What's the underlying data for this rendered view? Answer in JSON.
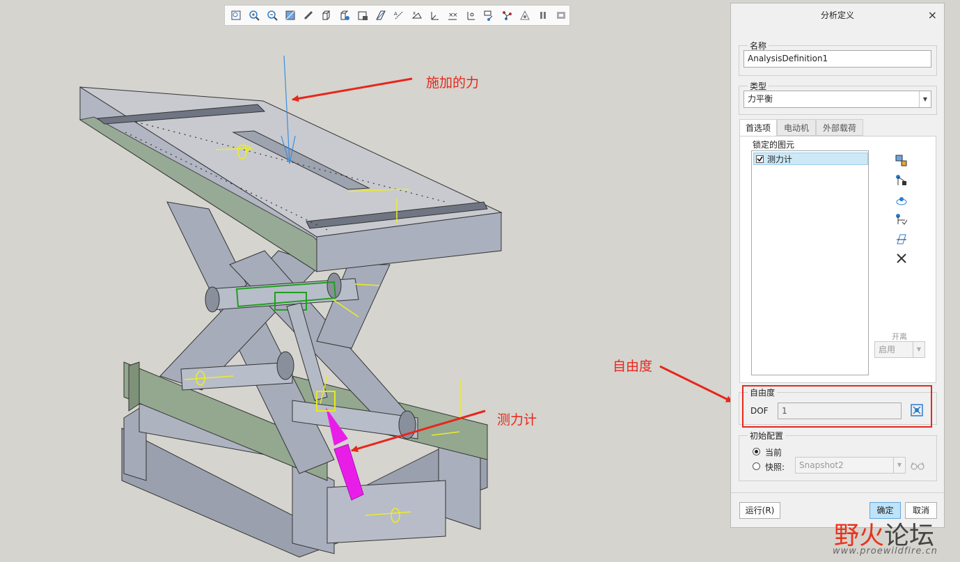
{
  "toolbar": {
    "icons": [
      "zoom-fit-icon",
      "zoom-in-icon",
      "zoom-out-icon",
      "repaint-icon",
      "orient-icon",
      "display-style-icon",
      "view-manager-icon",
      "saved-views-icon",
      "datum-planes-icon",
      "datum-axes-icon",
      "point-display-icon",
      "csys-display-icon",
      "spin-center-icon",
      "annotation-display-icon",
      "mechanism-display-icon",
      "joint-icon",
      "play-icon",
      "pause-icon",
      "stop-icon"
    ]
  },
  "annotations": {
    "force": "施加的力",
    "gauge": "测力计",
    "dof": "自由度"
  },
  "dialog": {
    "title": "分析定义",
    "close": "×",
    "name_label": "名称",
    "name_value": "AnalysisDefinition1",
    "type_label": "类型",
    "type_value": "力平衡",
    "tabs": [
      "首选项",
      "电动机",
      "外部载荷"
    ],
    "locked_label": "锁定的图元",
    "locked_items": [
      {
        "label": "测力计",
        "checked": true
      }
    ],
    "separation_label": "开离",
    "separation_value": "启用",
    "dof_group": "自由度",
    "dof_label": "DOF",
    "dof_value": "1",
    "init_group": "初始配置",
    "radio_current": "当前",
    "radio_snapshot": "快照:",
    "snapshot_value": "Snapshot2",
    "run_button": "运行(R)",
    "ok_button": "确定",
    "cancel_button": "取消"
  },
  "watermark": {
    "text_a": "野火",
    "text_b": "论坛",
    "url": "www.proewildfire.cn"
  },
  "colors": {
    "annotation": "#e8261c",
    "highlight_box": "#e8261c",
    "ok_button": "#bfe3f8",
    "dynamometer": "#e81ee8",
    "model_gray": "#a7acba",
    "model_green": "#93a88f"
  }
}
